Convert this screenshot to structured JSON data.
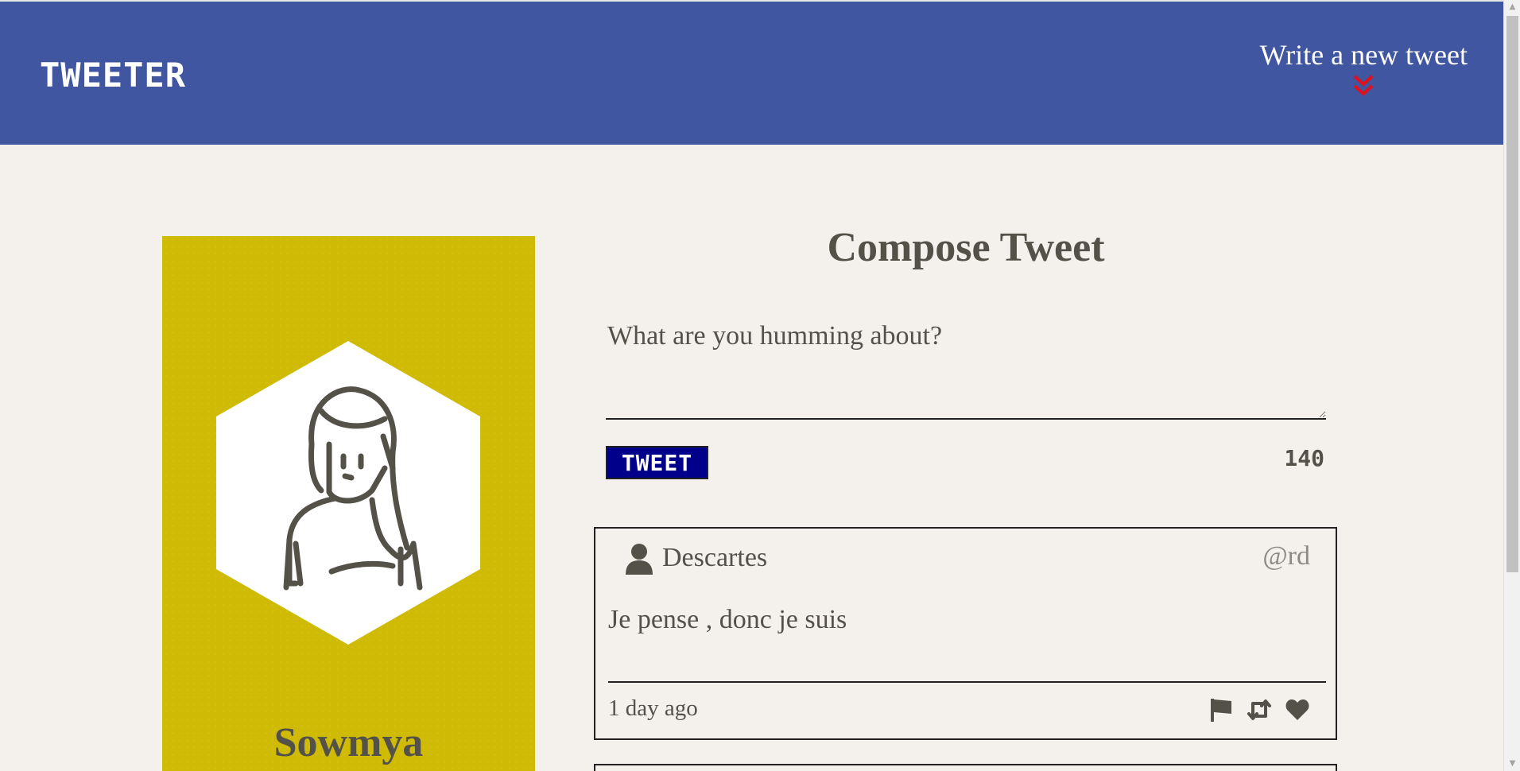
{
  "nav": {
    "brand": "TWEETER",
    "write_label": "Write a new tweet",
    "write_icon": "double-chevron-down-icon"
  },
  "profile": {
    "name": "Sowmya",
    "avatar_icon": "user-avatar-icon"
  },
  "compose": {
    "title": "Compose Tweet",
    "placeholder": "What are you humming about?",
    "value": "",
    "button_label": "TWEET",
    "counter": "140"
  },
  "tweets": [
    {
      "name": "Descartes",
      "handle": "@rd",
      "text": "Je pense , donc je suis",
      "time": "1 day ago",
      "actions": [
        "flag-icon",
        "retweet-icon",
        "heart-icon"
      ]
    }
  ],
  "colors": {
    "nav_bg": "#4056a1",
    "page_bg": "#f4f1ec",
    "profile_bg": "#cfbb05",
    "text": "#545149",
    "button_bg": "#00008b",
    "accent": "#e0101c"
  }
}
